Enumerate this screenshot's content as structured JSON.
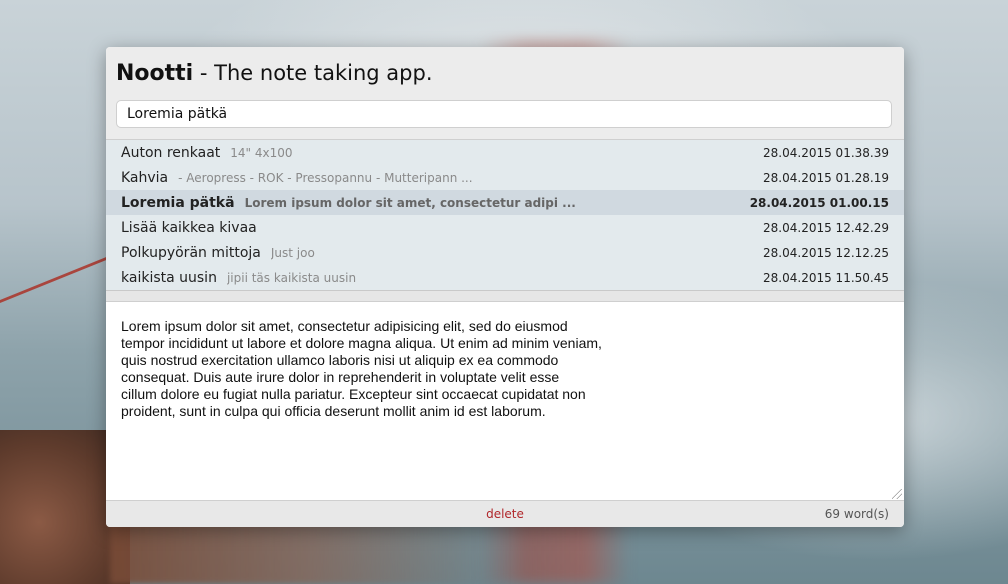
{
  "app": {
    "name": "Nootti",
    "tagline": "- The note taking app."
  },
  "search": {
    "value": "Loremia pätkä"
  },
  "notes": [
    {
      "title": "Auton renkaat",
      "preview": "14\" 4x100",
      "date": "28.04.2015 01.38.39",
      "selected": false
    },
    {
      "title": "Kahvia",
      "preview": "- Aeropress - ROK - Pressopannu - Mutteripann ...",
      "date": "28.04.2015 01.28.19",
      "selected": false
    },
    {
      "title": "Loremia pätkä",
      "preview": "Lorem ipsum dolor sit amet, consectetur adipi ...",
      "date": "28.04.2015 01.00.15",
      "selected": true
    },
    {
      "title": "Lisää kaikkea kivaa",
      "preview": "",
      "date": "28.04.2015 12.42.29",
      "selected": false
    },
    {
      "title": "Polkupyörän mittoja",
      "preview": "Just joo",
      "date": "28.04.2015 12.12.25",
      "selected": false
    },
    {
      "title": "kaikista uusin",
      "preview": "jipii täs kaikista uusin",
      "date": "28.04.2015 11.50.45",
      "selected": false
    }
  ],
  "editor": {
    "lines": [
      "Lorem ipsum dolor sit amet, consectetur adipisicing elit, sed do eiusmod",
      "tempor incididunt ut labore et dolore magna aliqua. Ut enim ad minim veniam,",
      "quis nostrud exercitation ullamco laboris nisi ut aliquip ex ea commodo",
      "consequat. Duis aute irure dolor in reprehenderit in voluptate velit esse",
      "cillum dolore eu fugiat nulla pariatur. Excepteur sint occaecat cupidatat non",
      "proident, sunt in culpa qui officia deserunt mollit anim id est laborum."
    ]
  },
  "footer": {
    "delete_label": "delete",
    "word_count": "69 word(s)"
  },
  "colors": {
    "delete": "#b0262a",
    "selected_row": "#cdd7de"
  }
}
